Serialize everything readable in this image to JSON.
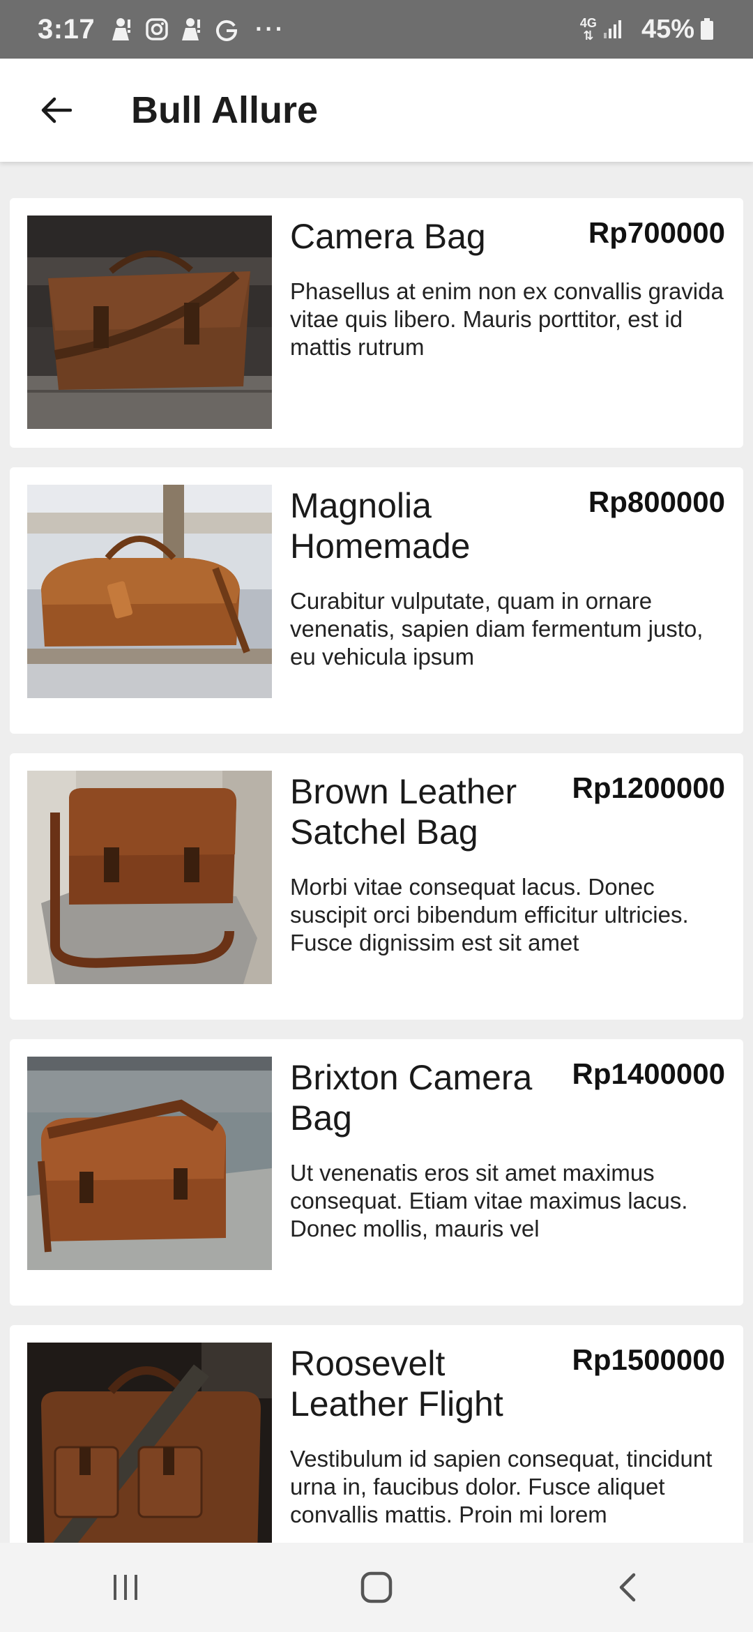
{
  "status_bar": {
    "time": "3:17",
    "network": "4G",
    "battery": "45%",
    "more": "···",
    "icons": [
      "person-alert-icon",
      "instagram-icon",
      "person-alert-icon",
      "google-icon",
      "signal-icon",
      "battery-icon"
    ]
  },
  "app_bar": {
    "title": "Bull Allure",
    "back_icon": "arrow-left-icon"
  },
  "products": [
    {
      "name": "Camera Bag",
      "price": "Rp700000",
      "description": "Phasellus at enim non ex convallis gravida vitae quis libero. Mauris porttitor, est id mattis rutrum"
    },
    {
      "name": "Magnolia Homemade",
      "price": "Rp800000",
      "description": "Curabitur vulputate, quam in ornare venenatis, sapien diam fermentum justo, eu vehicula ipsum"
    },
    {
      "name": "Brown Leather Satchel Bag",
      "price": "Rp1200000",
      "description": "Morbi vitae consequat lacus. Donec suscipit orci bibendum efficitur ultricies. Fusce dignissim est sit amet"
    },
    {
      "name": "Brixton Camera Bag",
      "price": "Rp1400000",
      "description": "Ut venenatis eros sit amet maximus consequat. Etiam vitae maximus lacus. Donec mollis, mauris vel"
    },
    {
      "name": "Roosevelt Leather Flight",
      "price": "Rp1500000",
      "description": "Vestibulum id sapien consequat, tincidunt urna in, faucibus dolor. Fusce aliquet convallis mattis. Proin mi lorem"
    }
  ],
  "nav_bar": {
    "icons": [
      "recent-apps-icon",
      "home-icon",
      "back-icon"
    ]
  },
  "colors": {
    "status_bar": "#6e6e6e",
    "page_background": "#eeeeee",
    "card_background": "#ffffff",
    "leather": "#8a4a22"
  }
}
